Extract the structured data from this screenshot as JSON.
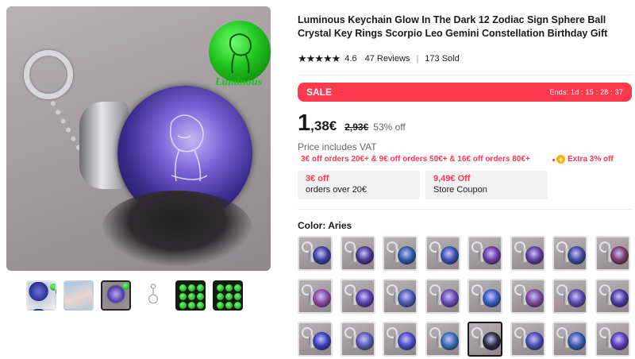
{
  "product": {
    "title": "Luminous Keychain Glow In The Dark 12 Zodiac Sign Sphere Ball Crystal Key Rings Scorpio Leo Gemini Constellation Birthday Gift",
    "rating_value": "4.6",
    "reviews": "47 Reviews",
    "sold": "173 Sold",
    "stars": "★★★★★"
  },
  "gallery": {
    "badge_text": "Luminous",
    "thumbnail_count": 6
  },
  "sale": {
    "label": "SALE",
    "ends": "Ends: 1d : 15 : 28 : 37"
  },
  "price": {
    "integer": "1",
    "decimal": ",38€",
    "old": "2,93€",
    "discount": "53% off",
    "vat_note": "Price includes VAT"
  },
  "promotions": {
    "tiers": "3€ off orders 20€+ & 9€ off orders 50€+ & 16€ off orders 80€+",
    "extra": "Extra 3% off"
  },
  "coupons": [
    {
      "amount": "3€ off",
      "condition": "orders over 20€"
    },
    {
      "amount": "9,49€ Off",
      "condition": "Store Coupon"
    }
  ],
  "variant": {
    "color_label": "Color: Aries",
    "selected_index": 20
  },
  "colors": {
    "accent": "#fd384f",
    "text": "#191919",
    "muted": "#666666",
    "coupon_bg": "#f2f2f2",
    "glow_green": "#20c41f",
    "icon_yellow": "#ffb300"
  },
  "icons": {
    "star": "star-icon",
    "plus": "plus-circle-icon"
  }
}
